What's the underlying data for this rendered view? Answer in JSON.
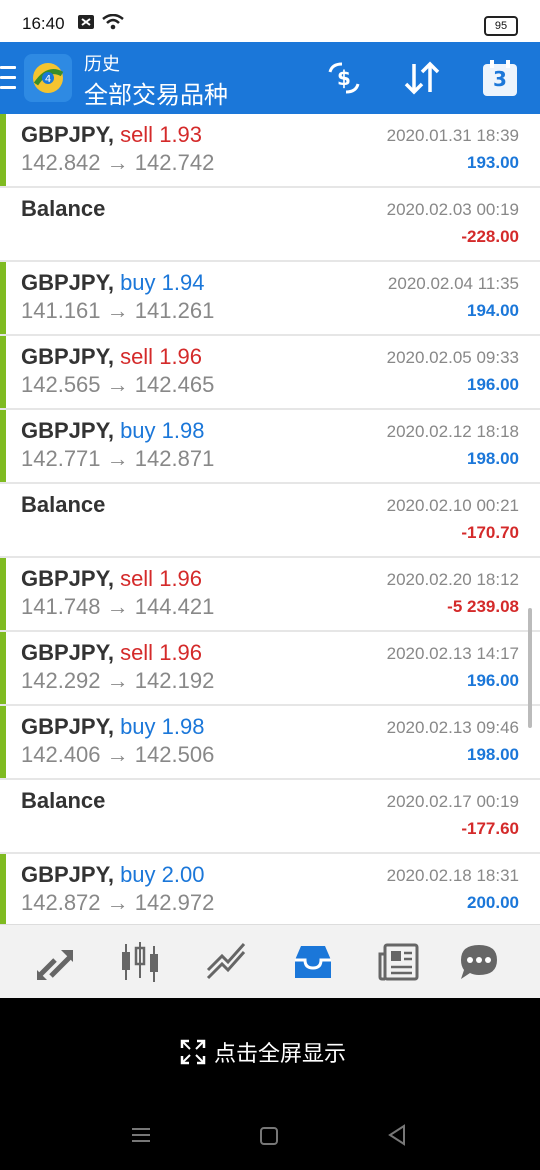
{
  "status": {
    "time": "16:40",
    "battery": "95"
  },
  "header": {
    "title": "历史",
    "subtitle": "全部交易品种"
  },
  "trades": [
    {
      "symbol": "GBPJPY,",
      "side": "sell",
      "volume": "1.93",
      "open_price": "142.842",
      "close_price": "142.742",
      "time": "2020.01.31 18:39",
      "profit": "193.00"
    },
    {
      "symbol": "Balance",
      "time": "2020.02.03 00:19",
      "profit": "-228.00"
    },
    {
      "symbol": "GBPJPY,",
      "side": "buy",
      "volume": "1.94",
      "open_price": "141.161",
      "close_price": "141.261",
      "time": "2020.02.04 11:35",
      "profit": "194.00"
    },
    {
      "symbol": "GBPJPY,",
      "side": "sell",
      "volume": "1.96",
      "open_price": "142.565",
      "close_price": "142.465",
      "time": "2020.02.05 09:33",
      "profit": "196.00"
    },
    {
      "symbol": "GBPJPY,",
      "side": "buy",
      "volume": "1.98",
      "open_price": "142.771",
      "close_price": "142.871",
      "time": "2020.02.12 18:18",
      "profit": "198.00"
    },
    {
      "symbol": "Balance",
      "time": "2020.02.10 00:21",
      "profit": "-170.70"
    },
    {
      "symbol": "GBPJPY,",
      "side": "sell",
      "volume": "1.96",
      "open_price": "141.748",
      "close_price": "144.421",
      "time": "2020.02.20 18:12",
      "profit": "-5 239.08"
    },
    {
      "symbol": "GBPJPY,",
      "side": "sell",
      "volume": "1.96",
      "open_price": "142.292",
      "close_price": "142.192",
      "time": "2020.02.13 14:17",
      "profit": "196.00"
    },
    {
      "symbol": "GBPJPY,",
      "side": "buy",
      "volume": "1.98",
      "open_price": "142.406",
      "close_price": "142.506",
      "time": "2020.02.13 09:46",
      "profit": "198.00"
    },
    {
      "symbol": "Balance",
      "time": "2020.02.17 00:19",
      "profit": "-177.60"
    },
    {
      "symbol": "GBPJPY,",
      "side": "buy",
      "volume": "2.00",
      "open_price": "142.872",
      "close_price": "142.972",
      "time": "2020.02.18 18:31",
      "profit": "200.00"
    }
  ],
  "header_icons": [
    "currency-exchange-icon",
    "sort-icon",
    "calendar-icon"
  ],
  "calendar_day": "3",
  "nav_items": [
    "quotes-icon",
    "chart-icon",
    "trade-icon",
    "history-icon",
    "news-icon",
    "chat-icon"
  ],
  "nav_active": "history-icon",
  "fullscreen": {
    "label": "点击全屏显示"
  },
  "colors": {
    "header": "#1b77d9",
    "sell": "#d42a2a",
    "buy": "#1b77d9",
    "marker": "#7fbb21"
  }
}
